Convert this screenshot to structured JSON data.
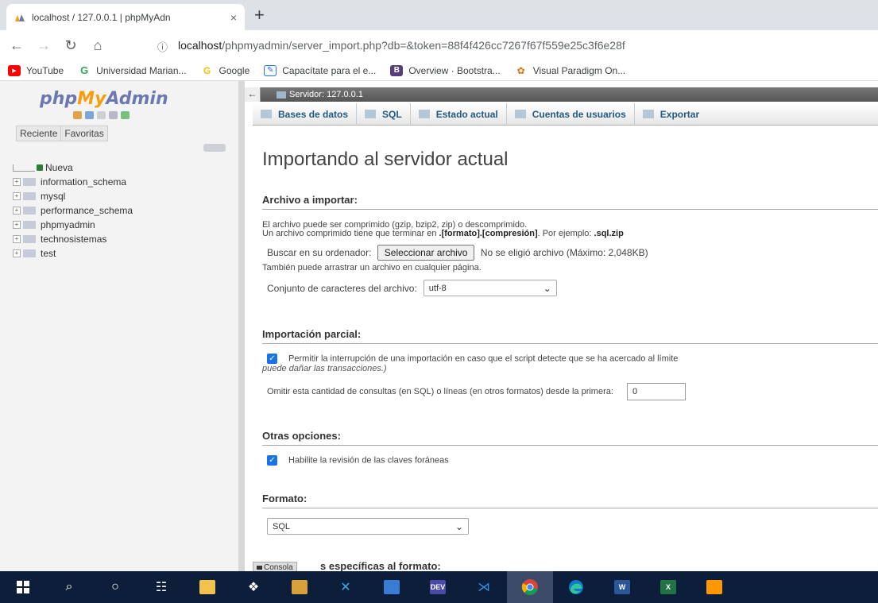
{
  "browser": {
    "tab_title": "localhost / 127.0.0.1 | phpMyAdn",
    "tab_close": "×",
    "new_tab": "+",
    "address_host": "localhost",
    "address_path": "/phpmyadmin/server_import.php?db=&token=88f4f426cc7267f67f559e25c3f6e28f",
    "bookmarks": [
      {
        "label": "YouTube",
        "icon": "youtube-icon",
        "color": "#ff0000"
      },
      {
        "label": "Universidad Marian...",
        "icon": "google-icon",
        "color": "#34a853"
      },
      {
        "label": "Google",
        "icon": "google-icon",
        "color": "#fbbc05"
      },
      {
        "label": "Capacítate para el e...",
        "icon": "document-icon",
        "color": "#1a73e8"
      },
      {
        "label": "Overview · Bootstra...",
        "icon": "bootstrap-icon",
        "color": "#563d7c"
      },
      {
        "label": "Visual Paradigm On...",
        "icon": "visual-paradigm-icon",
        "color": "#e8710a"
      }
    ]
  },
  "sidebar": {
    "logo_php": "php",
    "logo_my": "My",
    "logo_admin": "Admin",
    "tabs": [
      "Reciente",
      "Favoritas"
    ],
    "databases": [
      "Nueva",
      "information_schema",
      "mysql",
      "performance_schema",
      "phpmyadmin",
      "technosistemas",
      "test"
    ]
  },
  "main": {
    "server_label": "Servidor: 127.0.0.1",
    "nav": [
      "Bases de datos",
      "SQL",
      "Estado actual",
      "Cuentas de usuarios",
      "Exportar"
    ],
    "title": "Importando al servidor actual",
    "file_section": {
      "title": "Archivo a importar:",
      "line1": "El archivo puede ser comprimido (gzip, bzip2, zip) o descomprimido.",
      "line2_prefix": "Un archivo comprimido tiene que terminar en ",
      "line2_bold": ".[formato].[compresión]",
      "line2_mid": ". Por ejemplo: ",
      "line2_example": ".sql.zip",
      "browse_label": "Buscar en su ordenador:",
      "file_button": "Seleccionar archivo",
      "no_file": "No se eligió archivo",
      "max_size": "(Máximo: 2,048KB)",
      "drag_note": "También puede arrastrar un archivo en cualquier página.",
      "charset_label": "Conjunto de caracteres del archivo:",
      "charset_value": "utf-8"
    },
    "partial_section": {
      "title": "Importación parcial:",
      "allow_interrupt": "Permitir la interrupción de una importación en caso que el script detecte que se ha acercado al límite",
      "allow_interrupt_note": "puede dañar las transacciones.)",
      "skip_label": "Omitir esta cantidad de consultas (en SQL) o líneas (en otros formatos) desde la primera:",
      "skip_value": "0"
    },
    "other_section": {
      "title": "Otras opciones:",
      "fk_check": "Habilite la revisión de las claves foráneas"
    },
    "format_section": {
      "title": "Formato:",
      "format_value": "SQL"
    },
    "format_specific_title": "s específicas al formato:",
    "console_label": "Consola"
  },
  "taskbar": {
    "items": [
      "windows-icon",
      "search-icon",
      "cortana-icon",
      "task-view-icon",
      "file-explorer-icon",
      "dropbox-icon",
      "store-icon",
      "vscode-alt-icon",
      "virtualbox-icon",
      "dev-icon",
      "vscode-icon",
      "chrome-icon",
      "edge-icon",
      "word-icon",
      "excel-icon",
      "sublime-icon"
    ]
  }
}
